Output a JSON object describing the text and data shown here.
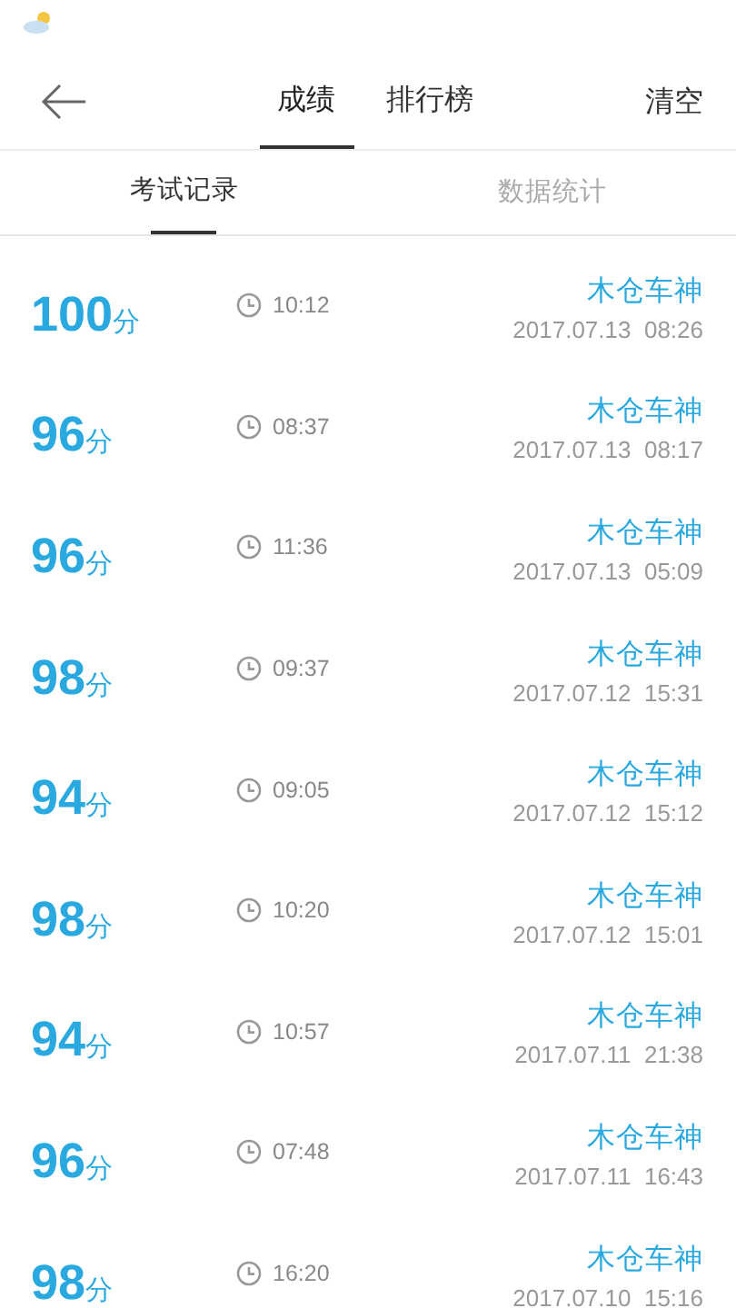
{
  "header": {
    "tabs": [
      {
        "label": "成绩",
        "selected": true
      },
      {
        "label": "排行榜",
        "selected": false
      }
    ],
    "action": "清空"
  },
  "subtabs": [
    {
      "label": "考试记录",
      "selected": true
    },
    {
      "label": "数据统计",
      "selected": false
    }
  ],
  "records": [
    {
      "score": "100",
      "unit": "分",
      "duration": "10:12",
      "name": "木仓车神",
      "date": "2017.07.13  08:26"
    },
    {
      "score": "96",
      "unit": "分",
      "duration": "08:37",
      "name": "木仓车神",
      "date": "2017.07.13  08:17"
    },
    {
      "score": "96",
      "unit": "分",
      "duration": "11:36",
      "name": "木仓车神",
      "date": "2017.07.13  05:09"
    },
    {
      "score": "98",
      "unit": "分",
      "duration": "09:37",
      "name": "木仓车神",
      "date": "2017.07.12  15:31"
    },
    {
      "score": "94",
      "unit": "分",
      "duration": "09:05",
      "name": "木仓车神",
      "date": "2017.07.12  15:12"
    },
    {
      "score": "98",
      "unit": "分",
      "duration": "10:20",
      "name": "木仓车神",
      "date": "2017.07.12  15:01"
    },
    {
      "score": "94",
      "unit": "分",
      "duration": "10:57",
      "name": "木仓车神",
      "date": "2017.07.11  21:38"
    },
    {
      "score": "96",
      "unit": "分",
      "duration": "07:48",
      "name": "木仓车神",
      "date": "2017.07.11  16:43"
    },
    {
      "score": "98",
      "unit": "分",
      "duration": "16:20",
      "name": "木仓车神",
      "date": "2017.07.10  15:16"
    }
  ]
}
